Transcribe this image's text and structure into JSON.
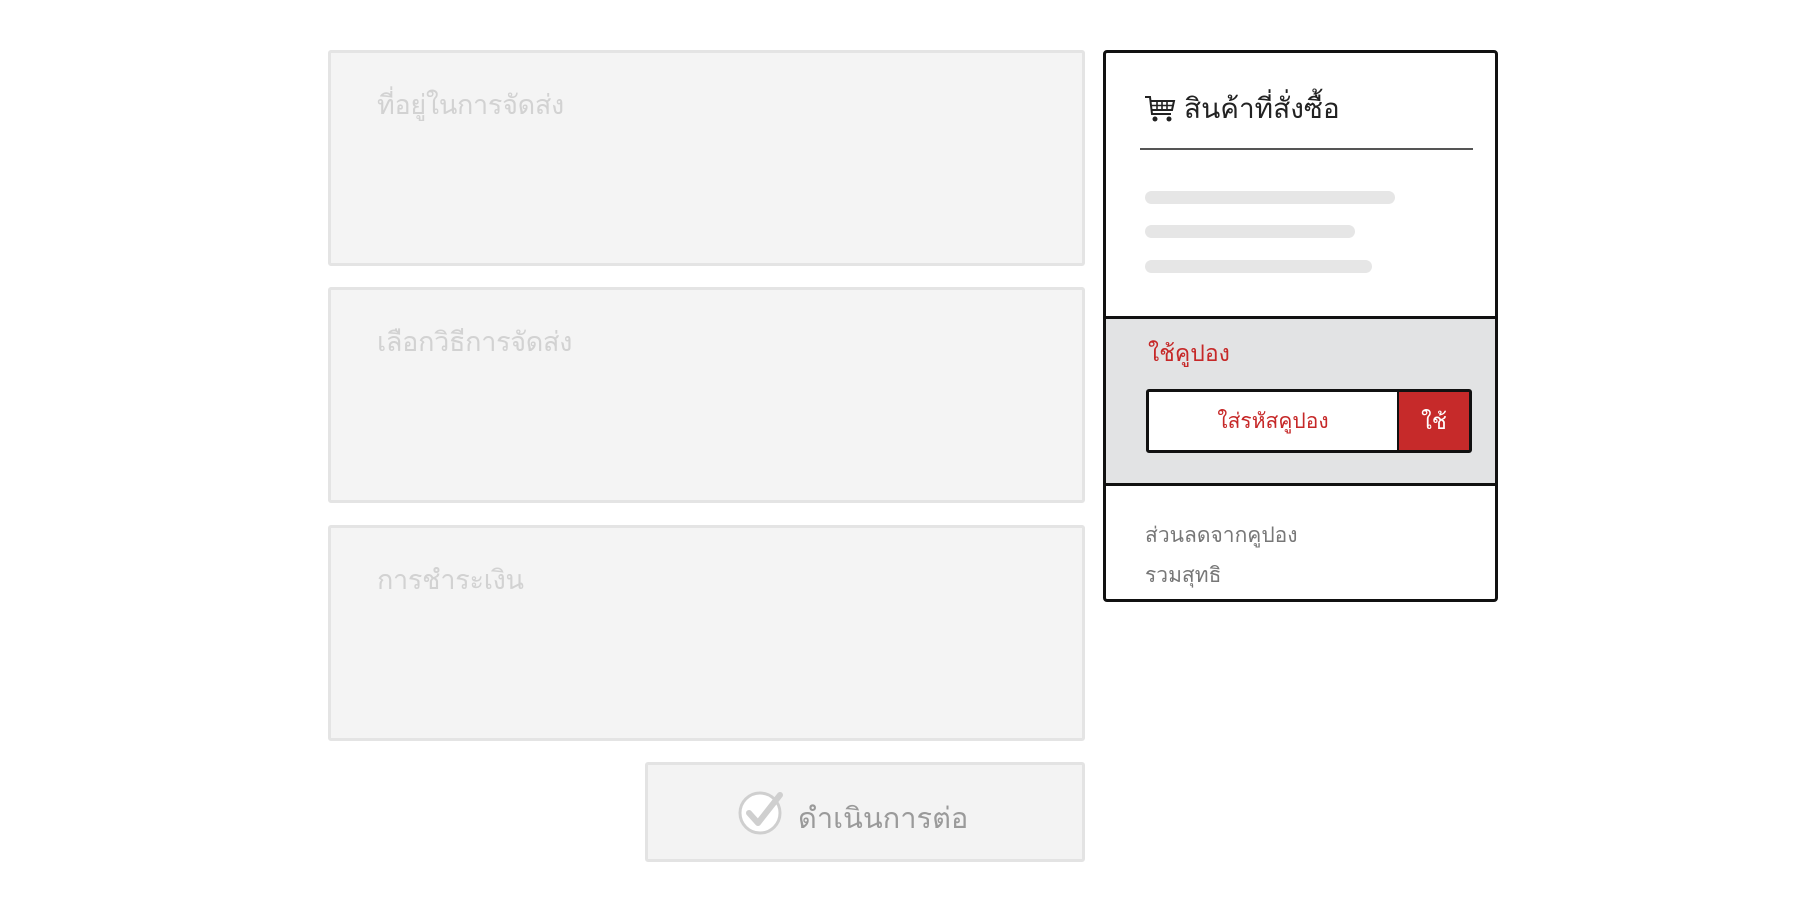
{
  "sections": {
    "address": {
      "title": "ที่อยู่ในการจัดส่ง"
    },
    "shipping": {
      "title": "เลือกวิธีการจัดส่ง"
    },
    "payment": {
      "title": "การชำระเงิน"
    }
  },
  "continue_button": {
    "label": "ดำเนินการต่อ",
    "icon": "check-circle-icon"
  },
  "summary": {
    "title": "สินค้าที่สั่งซื้อ",
    "icon": "shopping-cart-icon",
    "coupon": {
      "title": "ใช้คูปอง",
      "placeholder": "ใส่รหัสคูปอง",
      "apply_label": "ใช้"
    },
    "totals": {
      "discount_label": "ส่วนลดจากคูปอง",
      "net_total_label": "รวมสุทธิ"
    }
  },
  "colors": {
    "accent": "#c62a2a",
    "coupon_bg": "#e2e3e4",
    "placeholder_text": "#d2d2d2"
  }
}
